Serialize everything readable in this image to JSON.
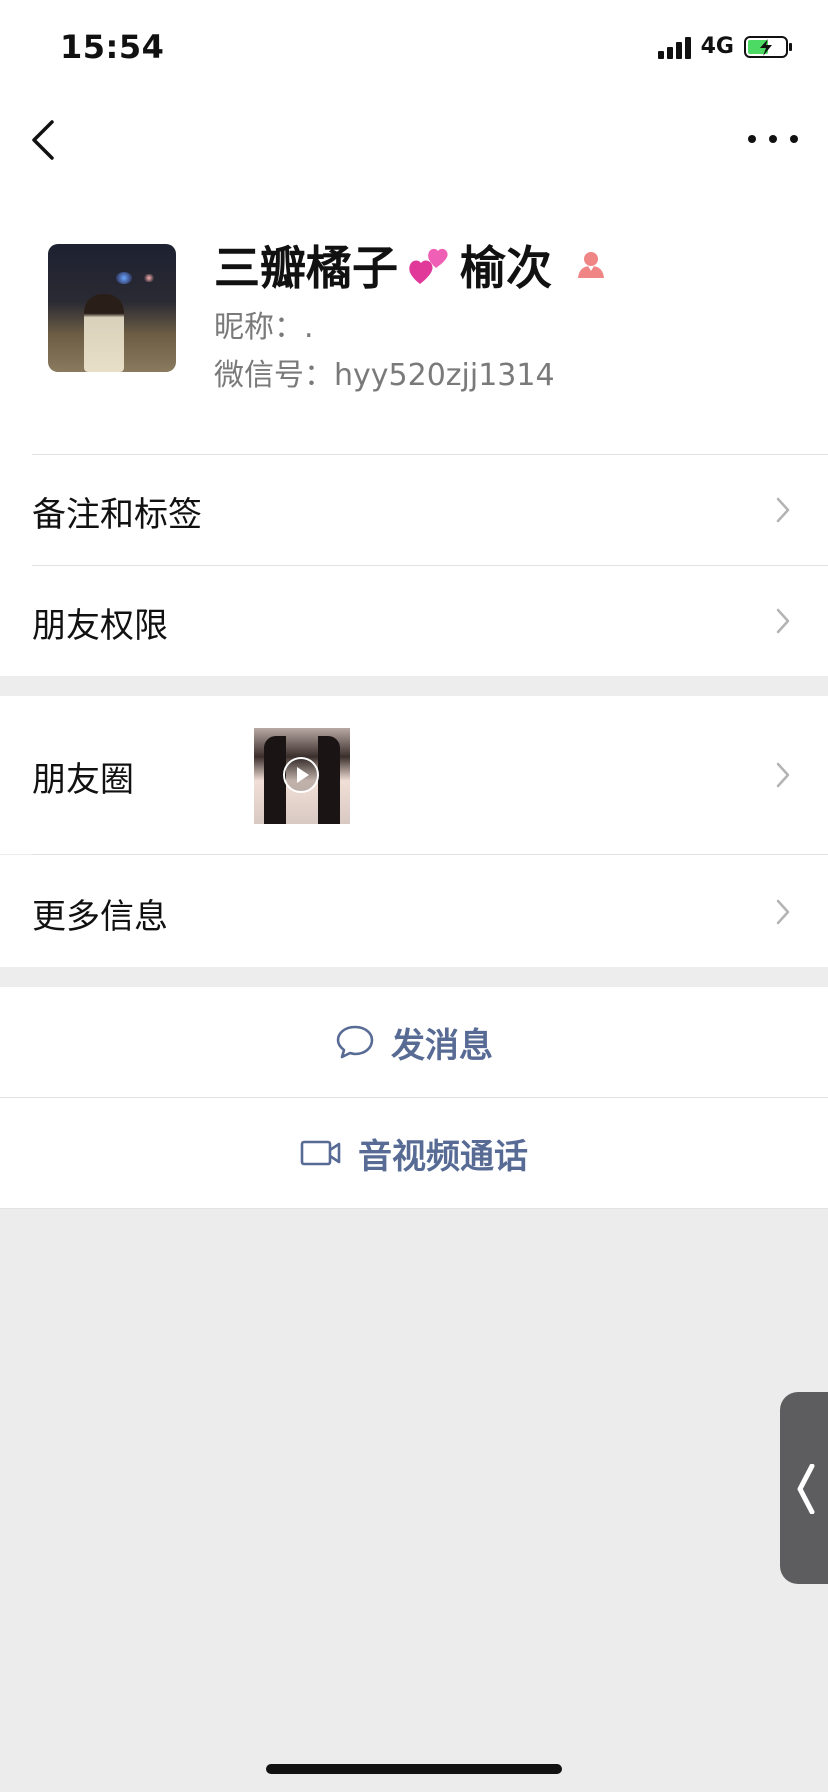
{
  "status_bar": {
    "time": "15:54",
    "network": "4G"
  },
  "profile": {
    "name_part1": "三瓣橘子",
    "name_part2": "榆次",
    "nickname": "昵称：.",
    "wechat_id": "微信号：hyy520zjj1314",
    "gender": "female"
  },
  "rows": {
    "remark_tags": "备注和标签",
    "friend_permissions": "朋友权限",
    "moments": "朋友圈",
    "more_info": "更多信息"
  },
  "actions": {
    "send_message": "发消息",
    "av_call": "音视频通话"
  },
  "colors": {
    "link": "#576b95",
    "gender_female": "#f08585",
    "battery_green": "#4cd964"
  }
}
